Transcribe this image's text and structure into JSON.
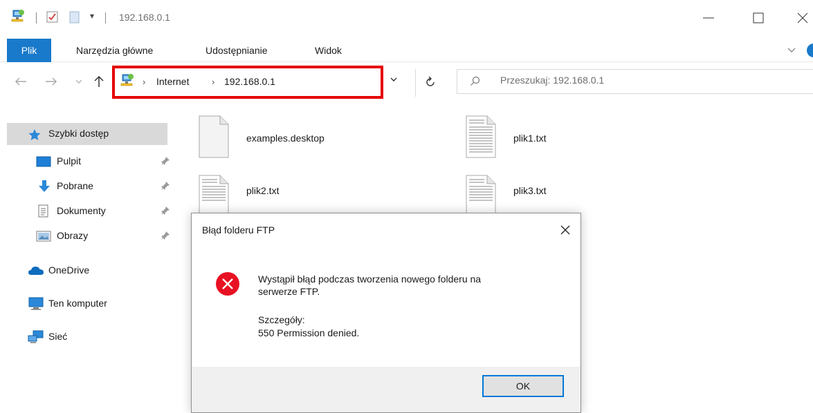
{
  "window": {
    "title": "192.168.0.1",
    "qat_dropdown_glyph": "▾",
    "minimize_icon": "minimize-icon",
    "maximize_icon": "maximize-icon",
    "close_icon": "close-icon"
  },
  "ribbon": {
    "tabs": [
      {
        "label": "Plik",
        "active": true
      },
      {
        "label": "Narzędzia główne"
      },
      {
        "label": "Udostępnianie"
      },
      {
        "label": "Widok"
      }
    ]
  },
  "address": {
    "segments": [
      "Internet",
      "192.168.0.1"
    ],
    "separator": "›"
  },
  "search": {
    "placeholder": "Przeszukaj: 192.168.0.1"
  },
  "sidebar": {
    "quick_access": "Szybki dostęp",
    "items": [
      {
        "label": "Pulpit",
        "icon": "desktop-icon",
        "pinned": true
      },
      {
        "label": "Pobrane",
        "icon": "downloads-icon",
        "pinned": true
      },
      {
        "label": "Dokumenty",
        "icon": "documents-icon",
        "pinned": true
      },
      {
        "label": "Obrazy",
        "icon": "pictures-icon",
        "pinned": true
      }
    ],
    "roots": [
      {
        "label": "OneDrive",
        "icon": "onedrive-icon"
      },
      {
        "label": "Ten komputer",
        "icon": "computer-icon"
      },
      {
        "label": "Sieć",
        "icon": "network-icon"
      }
    ]
  },
  "files": [
    {
      "name": "examples.desktop",
      "icon": "blank-file-icon"
    },
    {
      "name": "plik1.txt",
      "icon": "text-file-icon"
    },
    {
      "name": "plik2.txt",
      "icon": "text-file-icon"
    },
    {
      "name": "plik3.txt",
      "icon": "text-file-icon"
    }
  ],
  "dialog": {
    "title": "Błąd folderu FTP",
    "message_line1": "Wystąpił błąd podczas tworzenia nowego folderu na",
    "message_line2": "serwerze FTP.",
    "details_label": "Szczegóły:",
    "details": "550 Permission denied.",
    "ok_label": "OK"
  },
  "colors": {
    "accent": "#1979ca",
    "highlight_border": "#e60000",
    "error_icon": "#e81123",
    "selection": "#d9d9d9"
  }
}
